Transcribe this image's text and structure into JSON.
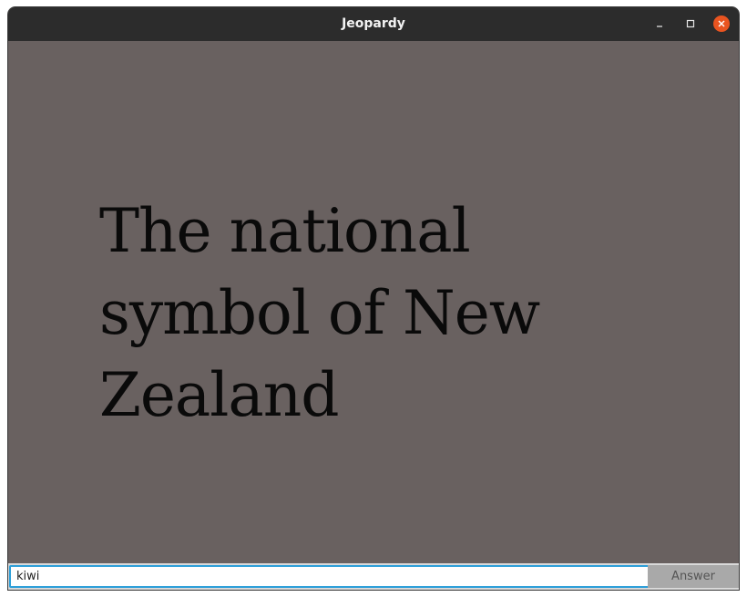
{
  "window": {
    "title": "Jeopardy"
  },
  "titlebar_buttons": {
    "minimize_icon": "minimize-icon",
    "maximize_icon": "maximize-icon",
    "close_icon": "close-icon"
  },
  "clue": {
    "text": "The national symbol of New Zealand"
  },
  "answer": {
    "input_value": "kiwi",
    "button_label": "Answer"
  },
  "colors": {
    "titlebar": "#2c2c2c",
    "background": "#696160",
    "close_button": "#e95420",
    "input_border": "#2d9fd9",
    "answer_button": "#a9a9a9"
  }
}
